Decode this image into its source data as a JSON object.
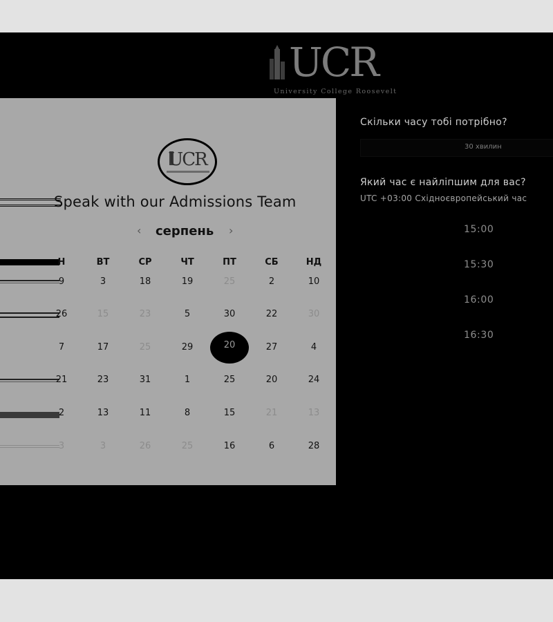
{
  "header": {
    "logo_text": "UCR",
    "logo_subtitle": "University College Roosevelt"
  },
  "card": {
    "logo_text": "UCR",
    "title": "Speak with our Admissions Team",
    "month": "серпень",
    "prev_icon": "chevron-left-icon",
    "next_icon": "chevron-right-icon",
    "weekdays": [
      "Н",
      "ВТ",
      "СР",
      "ЧТ",
      "ПТ",
      "СБ",
      "НД"
    ],
    "rows": [
      [
        {
          "t": "9",
          "m": false
        },
        {
          "t": "3",
          "m": false
        },
        {
          "t": "18",
          "m": false
        },
        {
          "t": "19",
          "m": false
        },
        {
          "t": "25",
          "m": true
        },
        {
          "t": "2",
          "m": false
        },
        {
          "t": "10",
          "m": false
        }
      ],
      [
        {
          "t": "26",
          "m": false
        },
        {
          "t": "15",
          "m": true
        },
        {
          "t": "23",
          "m": true
        },
        {
          "t": "5",
          "m": false
        },
        {
          "t": "30",
          "m": false
        },
        {
          "t": "22",
          "m": false
        },
        {
          "t": "30",
          "m": true
        }
      ],
      [
        {
          "t": "7",
          "m": false
        },
        {
          "t": "17",
          "m": false
        },
        {
          "t": "25",
          "m": true
        },
        {
          "t": "29",
          "m": false
        },
        {
          "t": "20",
          "m": false,
          "sel": true
        },
        {
          "t": "27",
          "m": false
        },
        {
          "t": "4",
          "m": false
        }
      ],
      [
        {
          "t": "21",
          "m": false
        },
        {
          "t": "23",
          "m": false
        },
        {
          "t": "31",
          "m": false
        },
        {
          "t": "1",
          "m": false
        },
        {
          "t": "25",
          "m": false
        },
        {
          "t": "20",
          "m": false
        },
        {
          "t": "24",
          "m": false
        }
      ],
      [
        {
          "t": "2",
          "m": false
        },
        {
          "t": "13",
          "m": false
        },
        {
          "t": "11",
          "m": false
        },
        {
          "t": "8",
          "m": false
        },
        {
          "t": "15",
          "m": false
        },
        {
          "t": "21",
          "m": true
        },
        {
          "t": "13",
          "m": true
        }
      ],
      [
        {
          "t": "3",
          "m": true
        },
        {
          "t": "3",
          "m": true
        },
        {
          "t": "26",
          "m": true
        },
        {
          "t": "25",
          "m": true
        },
        {
          "t": "16",
          "m": false
        },
        {
          "t": "6",
          "m": false
        },
        {
          "t": "28",
          "m": false
        }
      ]
    ]
  },
  "panel": {
    "duration_question": "Скільки часу тобі потрібно?",
    "duration_value": "30 хвилин",
    "time_question": "Який час є найліпшим для вас?",
    "timezone": "UTC +03:00 Східноєвропейський час",
    "slots": [
      "15:00",
      "15:30",
      "16:00",
      "16:30"
    ]
  },
  "colors": {
    "background": "#000000",
    "card": "#a8a8a8",
    "outer": "#e3e3e3",
    "selected_day": "#000000"
  }
}
